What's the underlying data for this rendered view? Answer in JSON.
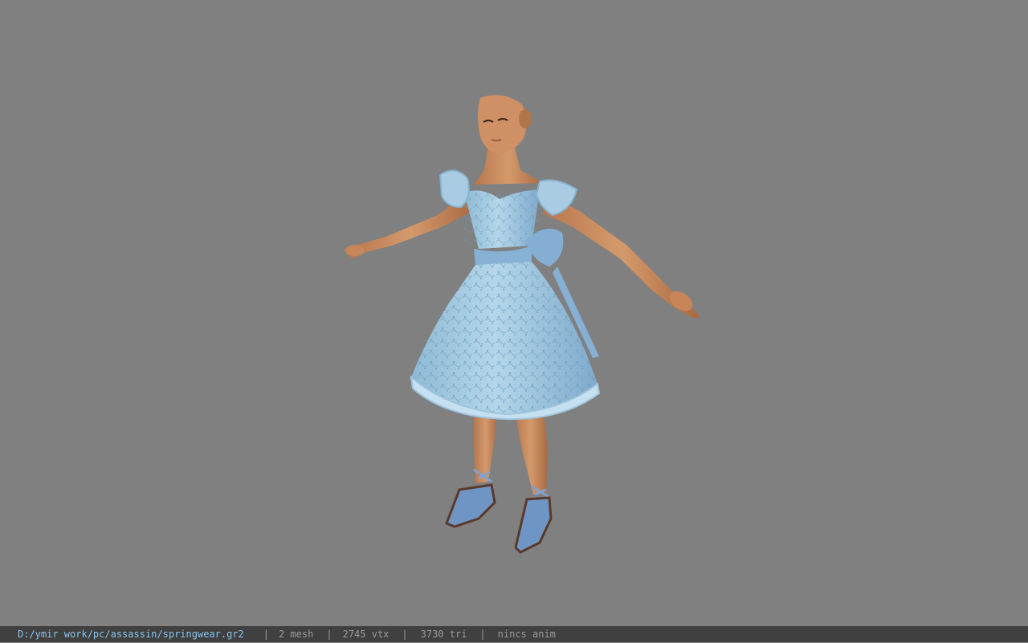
{
  "status_bar": {
    "file_path": "D:/ymir work/pc/assassin/springwear.gr2",
    "separator": "|",
    "mesh_count": "2 mesh",
    "vertex_count": "2745 vtx",
    "triangle_count": "3730 tri",
    "animation": "nincs anim"
  },
  "colors": {
    "viewport_background": "#808080",
    "status_bar_background": "#404040",
    "path_text": "#86c6ee",
    "status_text": "#9a9a9a",
    "dress": "#9cc4dd",
    "skin": "#c98a5e"
  },
  "scene": {
    "model": "character-model"
  }
}
